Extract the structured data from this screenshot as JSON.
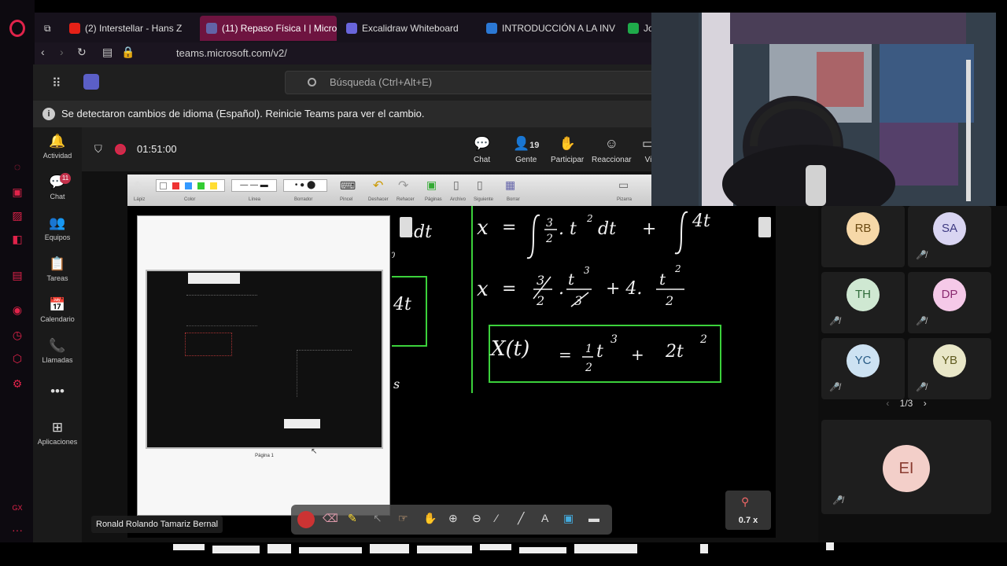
{
  "browser": {
    "tabs": [
      {
        "label": "(2) Interstellar - Hans Z",
        "color": "#e62117",
        "active": false
      },
      {
        "label": "(11) Repaso Física I | Micro",
        "color": "#6264a7",
        "active": true
      },
      {
        "label": "Excalidraw Whiteboard",
        "color": "#6965db",
        "active": false
      },
      {
        "label": "INTRODUCCIÓN A LA INV",
        "color": "#2b78d4",
        "active": false
      },
      {
        "label": "Jo",
        "color": "#1faa4a",
        "active": false
      }
    ],
    "url": "teams.microsoft.com/v2/",
    "accent": "#e0234a"
  },
  "teams": {
    "search_placeholder": "Búsqueda (Ctrl+Alt+E)",
    "banner": "Se detectaron cambios de idioma (Español). Reinicie Teams para ver el cambio.",
    "info_glyph": "i",
    "rail": [
      {
        "icon": "bell-icon",
        "glyph": "🔔",
        "label": "Actividad"
      },
      {
        "icon": "chat-icon",
        "glyph": "💬",
        "label": "Chat",
        "badge": "11"
      },
      {
        "icon": "teams-icon",
        "glyph": "👥",
        "label": "Equipos"
      },
      {
        "icon": "tasks-icon",
        "glyph": "📋",
        "label": "Tareas"
      },
      {
        "icon": "calendar-icon",
        "glyph": "📅",
        "label": "Calendario"
      },
      {
        "icon": "phone-icon",
        "glyph": "📞",
        "label": "Llamadas"
      },
      {
        "icon": "more-icon",
        "glyph": "•••",
        "label": ""
      },
      {
        "icon": "apps-icon",
        "glyph": "⊞",
        "label": "Aplicaciones"
      }
    ],
    "meeting": {
      "time": "01:51:00",
      "buttons": [
        {
          "glyph": "💬",
          "label": "Chat"
        },
        {
          "glyph": "👤",
          "label": "Gente",
          "count": "19"
        },
        {
          "glyph": "✋",
          "label": "Participar"
        },
        {
          "glyph": "☺",
          "label": "Reaccionar"
        },
        {
          "glyph": "▭",
          "label": "Vi"
        }
      ]
    }
  },
  "whiteboard": {
    "toolbar_labels": [
      "Lápiz",
      "Color",
      "Línea",
      "Borrador",
      "Pincel",
      "Deshacer",
      "Rehacer",
      "Páginas",
      "Archivo",
      "Siguiente",
      "Borrar",
      "Pizarra"
    ],
    "page_label": "Página 1",
    "zoom": "0.7 x",
    "math": {
      "line1": [
        "x",
        "=",
        "3",
        "2",
        ". t",
        "2",
        "dt",
        "+",
        "4t"
      ],
      "line2": [
        "x",
        "=",
        "3",
        "2",
        "t",
        "3",
        "3",
        "+ 4.",
        "t",
        "2",
        "2"
      ],
      "result": [
        "X(t)",
        "=",
        "1",
        "2",
        "t",
        "3",
        "+",
        "2t",
        "2"
      ],
      "partial_left": [
        "4dt",
        "4t",
        "s",
        "0",
        "0"
      ]
    }
  },
  "presenter_name": "Ronald Rolando Tamariz Bernal",
  "participants": [
    {
      "initials": "RB",
      "bg": "#f6d8a8",
      "fg": "#6b4a12",
      "muted": false
    },
    {
      "initials": "SA",
      "bg": "#d9d5f2",
      "fg": "#3e3a82",
      "muted": true
    },
    {
      "initials": "TH",
      "bg": "#cfe8d2",
      "fg": "#2f6b3a",
      "muted": true
    },
    {
      "initials": "DP",
      "bg": "#f5c9e8",
      "fg": "#8a2a70",
      "muted": true
    },
    {
      "initials": "YC",
      "bg": "#cde2f2",
      "fg": "#285b85",
      "muted": true
    },
    {
      "initials": "YB",
      "bg": "#e9e7c8",
      "fg": "#5f5b1f",
      "muted": true
    }
  ],
  "pager": "1/3",
  "featured": {
    "initials": "EI"
  }
}
